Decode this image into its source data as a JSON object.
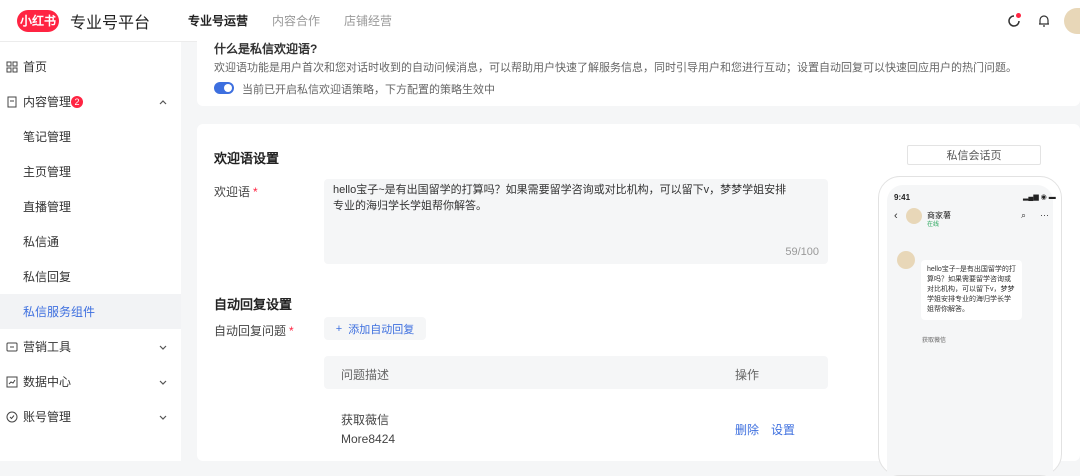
{
  "header": {
    "logo_text": "小红书",
    "brand": "专业号平台",
    "tabs": [
      {
        "label": "专业号运营",
        "active": true
      },
      {
        "label": "内容合作",
        "active": false
      },
      {
        "label": "店铺经营",
        "active": false
      }
    ]
  },
  "sidebar": {
    "items": [
      {
        "label": "首页",
        "icon": "grid-icon"
      },
      {
        "label": "内容管理",
        "icon": "document-icon",
        "badge": "2",
        "expanded": true
      },
      {
        "label": "笔记管理"
      },
      {
        "label": "主页管理"
      },
      {
        "label": "直播管理"
      },
      {
        "label": "私信通"
      },
      {
        "label": "私信回复"
      },
      {
        "label": "私信服务组件",
        "active": true
      },
      {
        "label": "营销工具",
        "icon": "megaphone-icon"
      },
      {
        "label": "数据中心",
        "icon": "chart-icon"
      },
      {
        "label": "账号管理",
        "icon": "shield-icon"
      }
    ]
  },
  "info": {
    "title": "什么是私信欢迎语?",
    "description": "欢迎语功能是用户首次和您对话时收到的自动问候消息，可以帮助用户快速了解服务信息，同时引导用户和您进行互动；设置自动回复可以快速回应用户的热门问题。",
    "toggle_on": true,
    "toggle_label": "当前已开启私信欢迎语策略，下方配置的策略生效中"
  },
  "welcome": {
    "section_title": "欢迎语设置",
    "label": "欢迎语",
    "required_mark": "*",
    "text": "hello宝子~是有出国留学的打算吗？如果需要留学咨询或对比机构，可以留下v，梦梦学姐安排专业的海归学长学姐帮你解答。",
    "count": "59/100"
  },
  "auto_reply": {
    "section_title": "自动回复设置",
    "label": "自动回复问题",
    "required_mark": "*",
    "add_button": "添加自动回复",
    "columns": [
      "问题描述",
      "操作"
    ],
    "rows": [
      {
        "question": "获取薇信",
        "answer": "More8424",
        "actions": [
          "删除",
          "设置"
        ]
      }
    ]
  },
  "preview": {
    "tab_label": "私信会话页",
    "time": "9:41",
    "shop_name": "商家薯",
    "online": "在线",
    "bubble_text": "hello宝子~是有出国留学的打算吗？如果需要留学咨询或对比机构，可以留下v，梦梦学姐安排专业的海归学长学姐帮你解答。",
    "chip": "获取薇信"
  },
  "colors": {
    "accent": "#3d6fdf",
    "brand_red": "#ff2442"
  }
}
